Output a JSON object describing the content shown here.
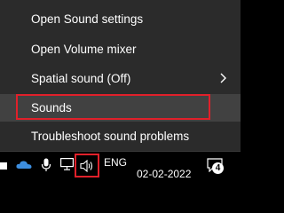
{
  "menu": {
    "items": [
      {
        "label": "Open Sound settings"
      },
      {
        "label": "Open Volume mixer"
      },
      {
        "label": "Spatial sound (Off)"
      },
      {
        "label": "Sounds"
      },
      {
        "label": "Troubleshoot sound problems"
      }
    ]
  },
  "taskbar": {
    "language": "ENG",
    "date": "02-02-2022",
    "notification_count": "4",
    "icons": [
      "onedrive-icon",
      "microphone-icon",
      "network-icon",
      "volume-icon",
      "notification-icon"
    ]
  },
  "colors": {
    "menu_bg": "#2b2b2b",
    "hover_bg": "#414141",
    "highlight": "#e0202a",
    "taskbar_bg": "#000000",
    "text": "#ffffff"
  }
}
